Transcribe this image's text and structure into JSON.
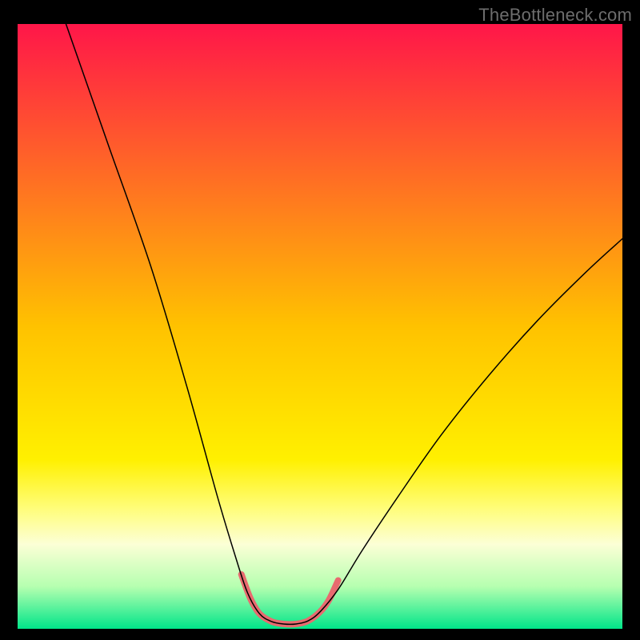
{
  "watermark": "TheBottleneck.com",
  "chart_data": {
    "type": "line",
    "title": "",
    "xlabel": "",
    "ylabel": "",
    "xlim": [
      0,
      100
    ],
    "ylim": [
      0,
      100
    ],
    "grid": false,
    "background_gradient": {
      "stops": [
        {
          "offset": 0.0,
          "color": "#ff1649"
        },
        {
          "offset": 0.5,
          "color": "#ffc200"
        },
        {
          "offset": 0.72,
          "color": "#fff000"
        },
        {
          "offset": 0.8,
          "color": "#fffd78"
        },
        {
          "offset": 0.86,
          "color": "#fcffd6"
        },
        {
          "offset": 0.93,
          "color": "#b6ffb0"
        },
        {
          "offset": 1.0,
          "color": "#00e589"
        }
      ]
    },
    "series": [
      {
        "name": "bottleneck-curve",
        "color": "#000000",
        "width": 1.5,
        "points": [
          {
            "x": 8.0,
            "y": 100.0
          },
          {
            "x": 15.0,
            "y": 80.0
          },
          {
            "x": 22.0,
            "y": 60.0
          },
          {
            "x": 28.0,
            "y": 40.0
          },
          {
            "x": 33.0,
            "y": 22.0
          },
          {
            "x": 36.0,
            "y": 12.0
          },
          {
            "x": 38.0,
            "y": 6.0
          },
          {
            "x": 40.0,
            "y": 2.5
          },
          {
            "x": 42.0,
            "y": 1.2
          },
          {
            "x": 44.0,
            "y": 0.8
          },
          {
            "x": 46.0,
            "y": 0.8
          },
          {
            "x": 48.0,
            "y": 1.3
          },
          {
            "x": 50.0,
            "y": 2.8
          },
          {
            "x": 53.0,
            "y": 6.5
          },
          {
            "x": 57.0,
            "y": 13.0
          },
          {
            "x": 63.0,
            "y": 22.0
          },
          {
            "x": 70.0,
            "y": 32.0
          },
          {
            "x": 78.0,
            "y": 42.0
          },
          {
            "x": 86.0,
            "y": 51.0
          },
          {
            "x": 94.0,
            "y": 59.0
          },
          {
            "x": 100.0,
            "y": 64.5
          }
        ]
      },
      {
        "name": "optimal-zone-highlight",
        "color": "#e86a6f",
        "width": 8,
        "points": [
          {
            "x": 37.0,
            "y": 9.0
          },
          {
            "x": 38.5,
            "y": 5.0
          },
          {
            "x": 40.0,
            "y": 2.5
          },
          {
            "x": 42.0,
            "y": 1.2
          },
          {
            "x": 44.0,
            "y": 0.8
          },
          {
            "x": 46.0,
            "y": 0.8
          },
          {
            "x": 48.0,
            "y": 1.3
          },
          {
            "x": 50.0,
            "y": 2.8
          },
          {
            "x": 51.5,
            "y": 4.8
          },
          {
            "x": 53.0,
            "y": 8.0
          }
        ]
      }
    ]
  }
}
